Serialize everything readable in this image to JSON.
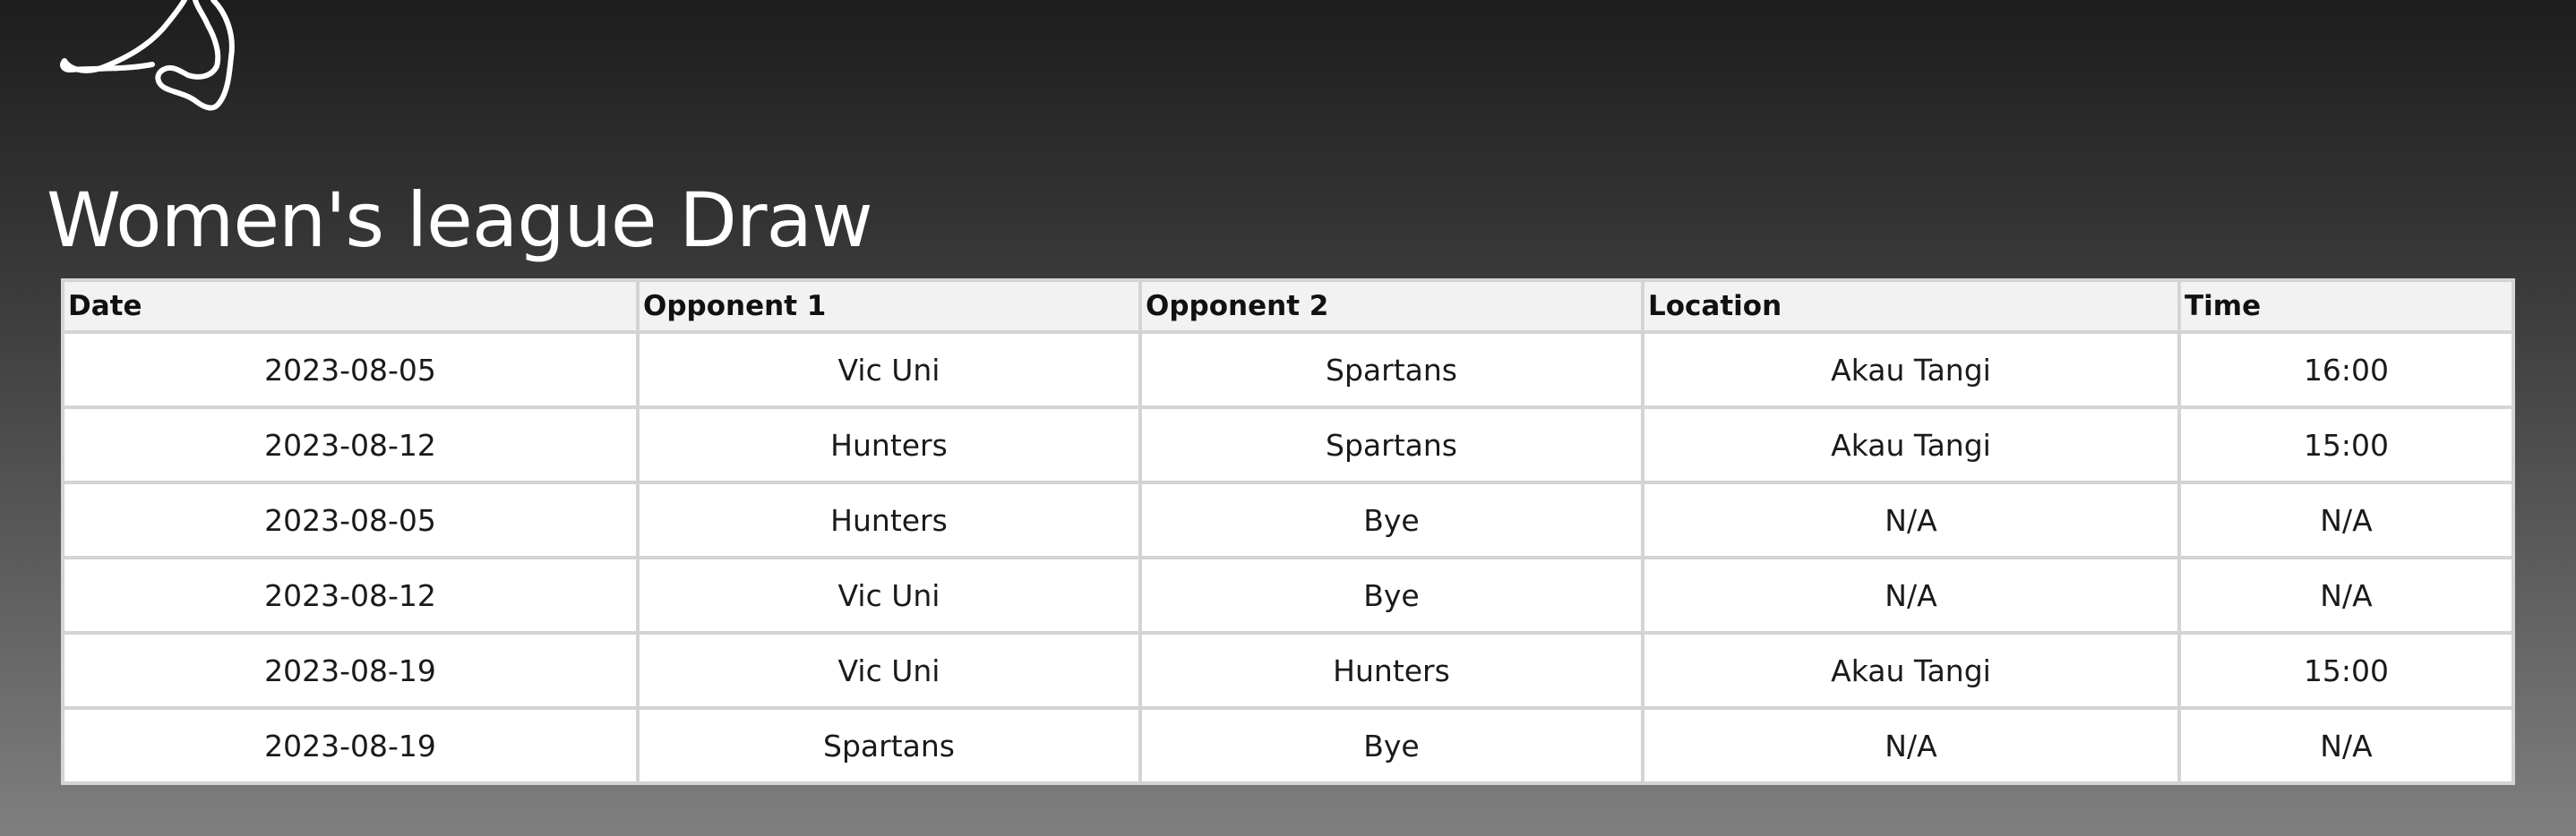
{
  "page": {
    "title": "Women's league Draw"
  },
  "logo": {
    "icon": "athlete-silhouette-icon",
    "color": "#ffffff"
  },
  "table": {
    "headers": [
      "Date",
      "Opponent 1",
      "Opponent 2",
      "Location",
      "Time"
    ],
    "rows": [
      [
        "2023-08-05",
        "Vic Uni",
        "Spartans",
        "Akau Tangi",
        "16:00"
      ],
      [
        "2023-08-12",
        "Hunters",
        "Spartans",
        "Akau Tangi",
        "15:00"
      ],
      [
        "2023-08-05",
        "Hunters",
        "Bye",
        "N/A",
        "N/A"
      ],
      [
        "2023-08-12",
        "Vic Uni",
        "Bye",
        "N/A",
        "N/A"
      ],
      [
        "2023-08-19",
        "Vic Uni",
        "Hunters",
        "Akau Tangi",
        "15:00"
      ],
      [
        "2023-08-19",
        "Spartans",
        "Bye",
        "N/A",
        "N/A"
      ]
    ]
  }
}
